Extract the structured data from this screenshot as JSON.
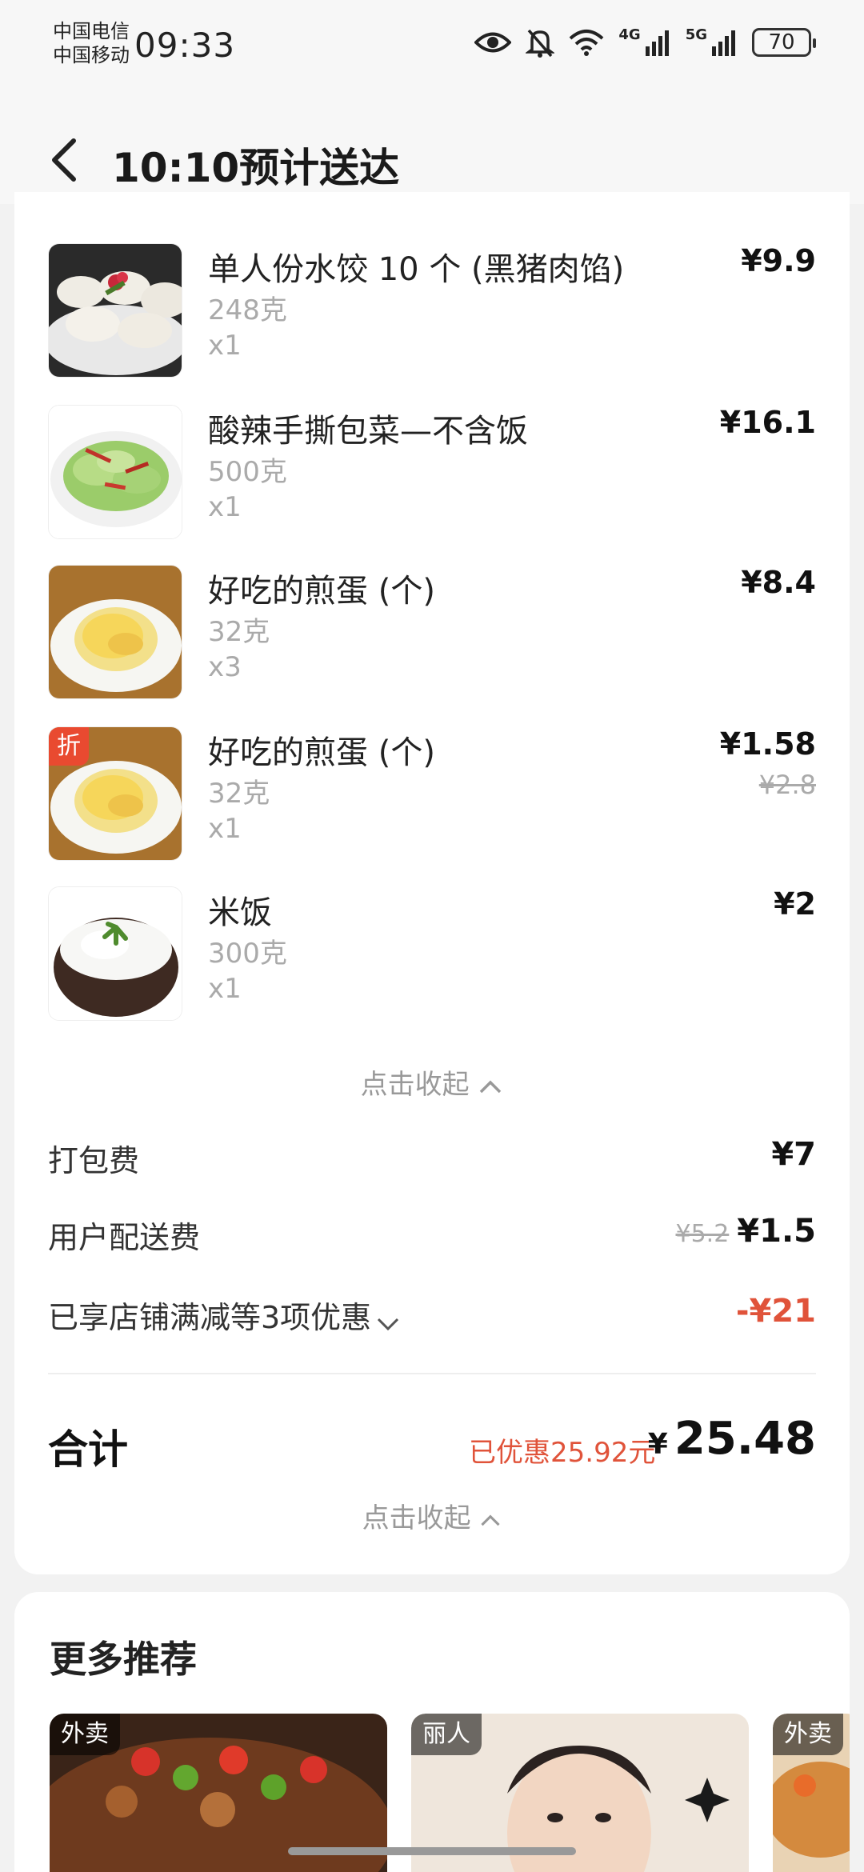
{
  "status_bar": {
    "carrier1": "中国电信",
    "carrier2": "中国移动",
    "time": "09:33",
    "net1": "4G",
    "net2": "5G",
    "battery": "70"
  },
  "header": {
    "title": "10:10预计送达",
    "back_icon": "chevron-left-icon"
  },
  "items": [
    {
      "name": "单人份水饺 10 个 (黑猪肉馅)",
      "weight": "248克",
      "qty": "x1",
      "price": "¥9.9",
      "original_price": ""
    },
    {
      "name": "酸辣手撕包菜—不含饭",
      "weight": "500克",
      "qty": "x1",
      "price": "¥16.1",
      "original_price": ""
    },
    {
      "name": "好吃的煎蛋 (个)",
      "weight": "32克",
      "qty": "x3",
      "price": "¥8.4",
      "original_price": ""
    },
    {
      "name": "好吃的煎蛋 (个)",
      "weight": "32克",
      "qty": "x1",
      "price": "¥1.58",
      "original_price": "¥2.8",
      "badge": "折"
    },
    {
      "name": "米饭",
      "weight": "300克",
      "qty": "x1",
      "price": "¥2",
      "original_price": ""
    }
  ],
  "collapse_label": "点击收起",
  "fees": {
    "packing_label": "打包费",
    "packing_value": "¥7",
    "delivery_label": "用户配送费",
    "delivery_original": "¥5.2",
    "delivery_value": "¥1.5",
    "discount_label": "已享店铺满减等3项优惠",
    "discount_value": "-¥21"
  },
  "total": {
    "label": "合计",
    "saved": "已优惠25.92元",
    "yen": "¥",
    "value": "25.48"
  },
  "collapse_label2": "点击收起",
  "recommend": {
    "title": "更多推荐",
    "cards": [
      {
        "tag": "外卖"
      },
      {
        "tag": "丽人"
      },
      {
        "tag": "外卖"
      }
    ]
  },
  "colors": {
    "accent_red": "#e0533a",
    "badge_red": "#e94a30"
  }
}
